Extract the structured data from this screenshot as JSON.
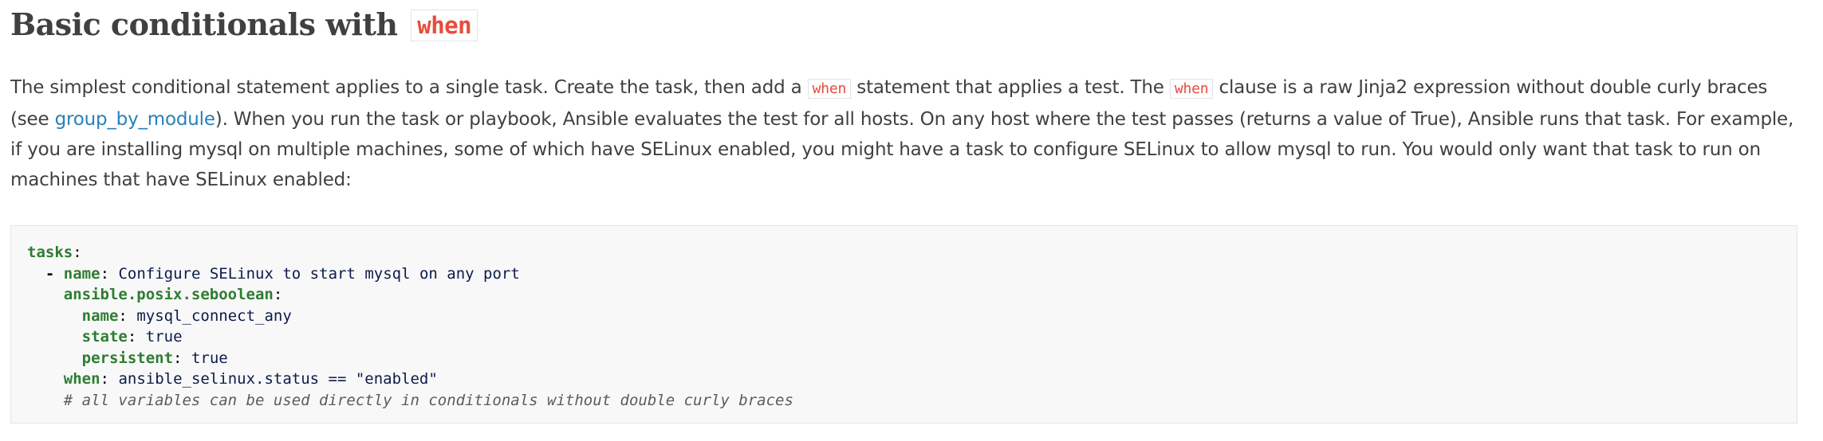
{
  "heading": {
    "text": "Basic conditionals with ",
    "code": "when"
  },
  "intro": {
    "t1": "The simplest conditional statement applies to a single task. Create the task, then add a ",
    "c1": "when",
    "t2": " statement that applies a test. The ",
    "c2": "when",
    "t3": " clause is a raw Jinja2 expression without double curly braces (see ",
    "link": "group_by_module",
    "t4": "). When you run the task or playbook, Ansible evaluates the test for all hosts. On any host where the test passes (returns a value of True), Ansible runs that task. For example, if you are installing mysql on multiple machines, some of which have SELinux enabled, you might have a task to configure SELinux to allow mysql to run. You would only want that task to run on machines that have SELinux enabled:"
  },
  "code": {
    "l1_key": "tasks",
    "l2_dash": "-",
    "l2_key": "name",
    "l2_val": "Configure SELinux to start mysql on any port",
    "l3_key": "ansible.posix.seboolean",
    "l4_key": "name",
    "l4_val": "mysql_connect_any",
    "l5_key": "state",
    "l5_val": "true",
    "l6_key": "persistent",
    "l6_val": "true",
    "l7_key": "when",
    "l7_val": "ansible_selinux.status == \"enabled\"",
    "l8_comment": "# all variables can be used directly in conditionals without double curly braces"
  }
}
